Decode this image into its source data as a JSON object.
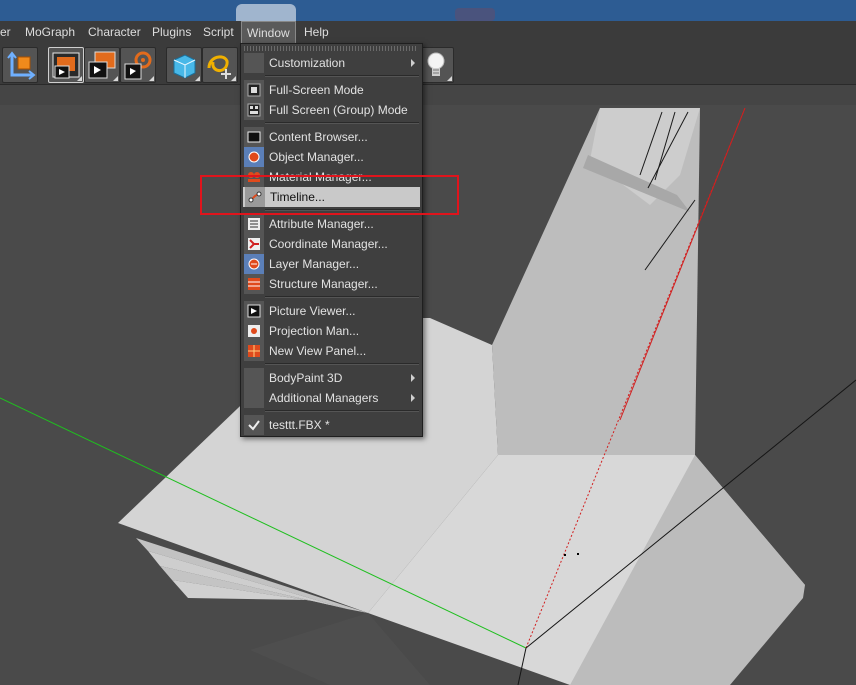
{
  "menubar": {
    "items": [
      {
        "label": "er"
      },
      {
        "label": "MoGraph"
      },
      {
        "label": "Character"
      },
      {
        "label": "Plugins"
      },
      {
        "label": "Script"
      },
      {
        "label": "Window"
      },
      {
        "label": "Help"
      }
    ],
    "active": "Window"
  },
  "toolbar": {
    "buttons": [
      {
        "name": "axis-tool-icon"
      },
      {
        "name": "object-cube-icon"
      },
      {
        "name": "render-view-icon"
      },
      {
        "name": "render-picture-viewer-icon"
      },
      {
        "name": "render-settings-icon"
      },
      {
        "name": "cube-primitive-icon"
      },
      {
        "name": "spline-pen-icon"
      },
      {
        "name": "light-bulb-icon"
      }
    ]
  },
  "window_menu": {
    "items": [
      {
        "label": "Customization",
        "submenu": true,
        "icon": "none"
      },
      {
        "label": "Full-Screen Mode",
        "icon": "fullscreen-icon"
      },
      {
        "label": "Full Screen (Group) Mode",
        "icon": "fullscreen-group-icon"
      },
      {
        "label": "Content Browser...",
        "icon": "content-browser-icon"
      },
      {
        "label": "Object Manager...",
        "icon": "object-manager-icon"
      },
      {
        "label": "Material Manager...",
        "icon": "material-manager-icon"
      },
      {
        "label": "Timeline...",
        "icon": "timeline-icon",
        "highlighted": true
      },
      {
        "label": "Attribute Manager...",
        "icon": "attribute-manager-icon"
      },
      {
        "label": "Coordinate Manager...",
        "icon": "coordinate-manager-icon"
      },
      {
        "label": "Layer Manager...",
        "icon": "layer-manager-icon"
      },
      {
        "label": "Structure Manager...",
        "icon": "structure-manager-icon"
      },
      {
        "label": "Picture Viewer...",
        "icon": "picture-viewer-icon"
      },
      {
        "label": "Projection Man...",
        "icon": "projection-manager-icon"
      },
      {
        "label": "New View Panel...",
        "icon": "new-view-panel-icon"
      },
      {
        "label": "BodyPaint 3D",
        "submenu": true,
        "icon": "none"
      },
      {
        "label": "Additional Managers",
        "submenu": true,
        "icon": "none"
      },
      {
        "label": "testtt.FBX *",
        "icon": "checkmark-icon"
      }
    ]
  },
  "annotation": {
    "color": "#e0141c",
    "target": "Timeline..."
  },
  "colors": {
    "title_strip": "#2d5c93",
    "menubar": "#3b3b3b",
    "viewport": "#4a4a4a",
    "x_axis": "#d21f1f",
    "z_axis": "#1fbf1f"
  }
}
